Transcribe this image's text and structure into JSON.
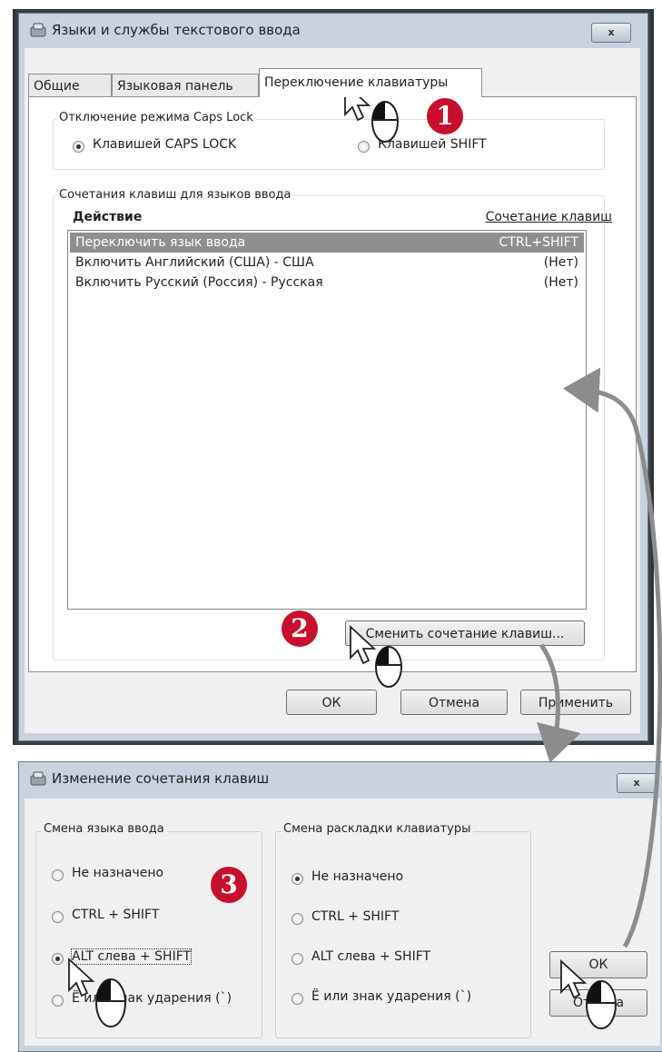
{
  "dialog1": {
    "title": "Языки и службы текстового ввода",
    "close_label": "x",
    "tabs": [
      "Общие",
      "Языковая панель",
      "Переключение клавиатуры"
    ],
    "capslock_group": {
      "title": "Отключение режима Caps Lock",
      "option1": "Клавишей CAPS LOCK",
      "option2": "Клавишей SHIFT",
      "selected": "option1"
    },
    "hotkeys_group": {
      "title": "Сочетания клавиш для языков ввода",
      "col_action": "Действие",
      "col_keys": "Сочетание клавиш",
      "rows": [
        {
          "action": "Переключить язык ввода",
          "keys": "CTRL+SHIFT",
          "selected": true
        },
        {
          "action": "Включить Английский (США) - США",
          "keys": "(Нет)",
          "selected": false
        },
        {
          "action": "Включить Русский (Россия) - Русская",
          "keys": "(Нет)",
          "selected": false
        }
      ],
      "change_button": "Сменить сочетание клавиш..."
    },
    "ok_button": "ОК",
    "cancel_button": "Отмена",
    "apply_button": "Применить"
  },
  "dialog2": {
    "title": "Изменение сочетания клавиш",
    "close_label": "x",
    "group_input_lang": {
      "title": "Смена языка ввода",
      "options": [
        "Не назначено",
        "CTRL + SHIFT",
        "ALT слева + SHIFT",
        "Ё или знак ударения (`)"
      ],
      "selected_index": 2
    },
    "group_layout": {
      "title": "Смена раскладки клавиатуры",
      "options": [
        "Не назначено",
        "CTRL + SHIFT",
        "ALT слева + SHIFT",
        "Ё или знак ударения (`)"
      ],
      "selected_index": 0
    },
    "ok_button": "ОК",
    "cancel_button": "Отмена"
  },
  "callouts": [
    "1",
    "2",
    "3"
  ],
  "colors": {
    "badge": "#c8102e",
    "arrow": "#8c8c8c",
    "selection": "#8f8f8f"
  }
}
